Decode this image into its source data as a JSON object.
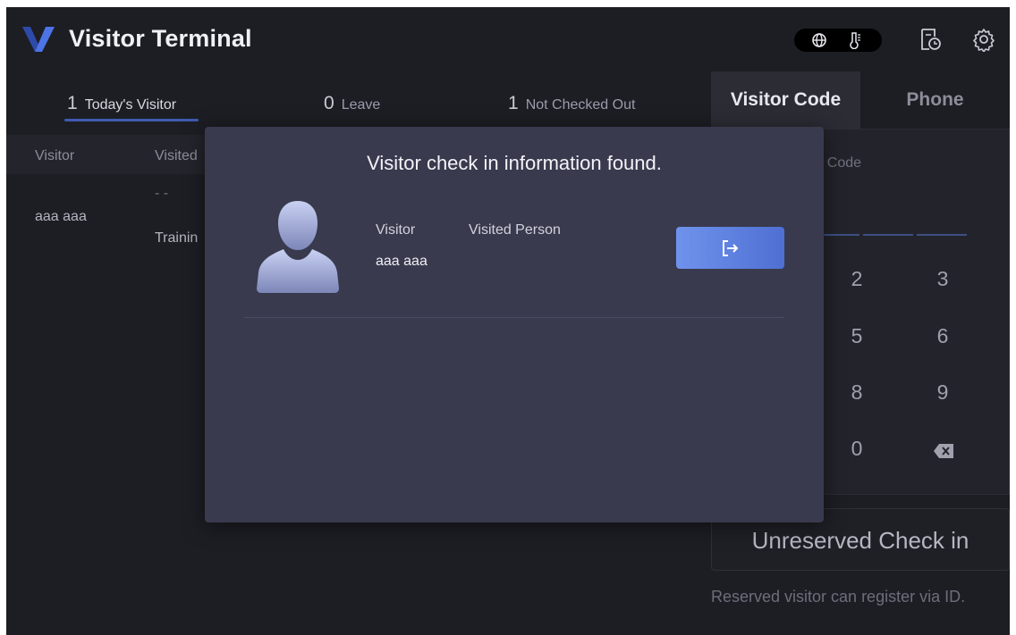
{
  "app": {
    "title": "Visitor Terminal",
    "brand_color": "#3f61c4"
  },
  "header_icons": {
    "pill": [
      "globe-icon",
      "thermometer-icon"
    ],
    "right": [
      "schedule-icon",
      "settings-gear-icon"
    ]
  },
  "tabs": [
    {
      "count": "1",
      "label": "Today's Visitor",
      "active": true
    },
    {
      "count": "0",
      "label": "Leave",
      "active": false
    },
    {
      "count": "1",
      "label": "Not Checked Out",
      "active": false
    }
  ],
  "table": {
    "columns": [
      "Visitor",
      "Visited"
    ],
    "rows": [
      {
        "visitor": "aaa aaa",
        "dash": "- -",
        "visited": "Trainin"
      }
    ]
  },
  "right_panel": {
    "tabs": [
      {
        "label": "Visitor Code",
        "active": true
      },
      {
        "label": "Phone",
        "active": false
      }
    ],
    "code_label": "r Code",
    "keypad": [
      [
        "2",
        "3"
      ],
      [
        "5",
        "6"
      ],
      [
        "8",
        "9"
      ],
      [
        "0",
        "backspace-icon"
      ]
    ],
    "unreserved_button": "Unreserved Check in",
    "hint": "Reserved visitor can register via ID."
  },
  "modal": {
    "title": "Visitor check in information found.",
    "visitor_label": "Visitor",
    "visitor_value": "aaa aaa",
    "visited_label": "Visited Person",
    "visited_value": "",
    "action_icon": "checkout-icon",
    "accent": "#5a7ddd"
  }
}
